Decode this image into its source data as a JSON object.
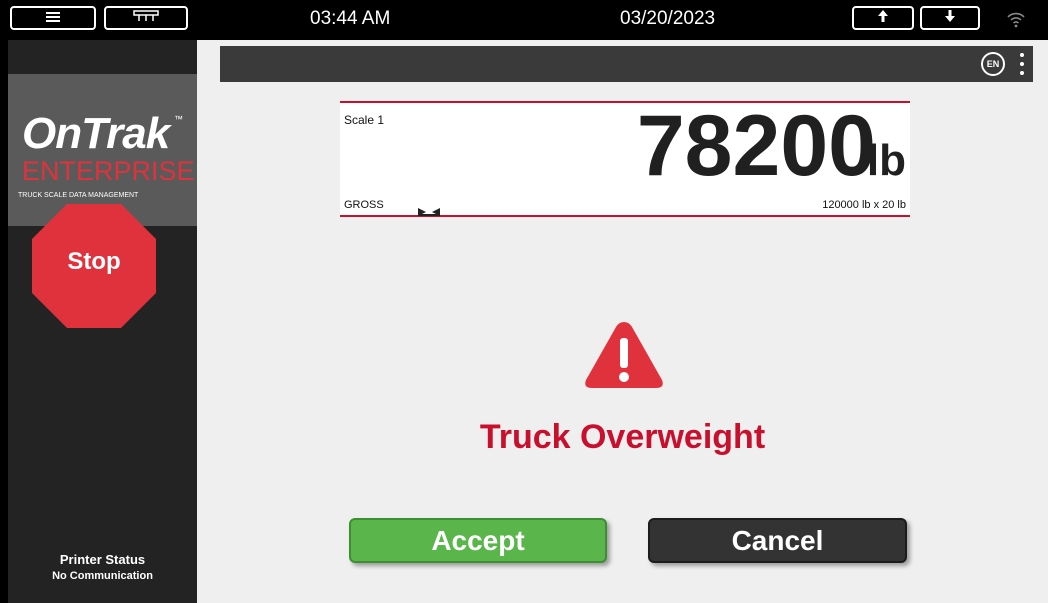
{
  "topbar": {
    "menu_icon": "hamburger-icon",
    "network_icon": "network-icon",
    "time": "03:44 AM",
    "date": "03/20/2023",
    "up_icon": "arrow-up-icon",
    "down_icon": "arrow-down-icon",
    "wifi_icon": "wifi-icon"
  },
  "sidebar": {
    "logo_main": "OnTrak",
    "logo_tm": "™",
    "logo_sub": "ENTERPRISE",
    "logo_tagline": "TRUCK SCALE DATA MANAGEMENT",
    "stop_label": "Stop",
    "printer_status_title": "Printer Status",
    "printer_status_value": "No Communication"
  },
  "header": {
    "language_badge": "EN",
    "menu_icon": "kebab-menu-icon"
  },
  "scale": {
    "name": "Scale 1",
    "weight": "78200",
    "unit": "lb",
    "mode": "GROSS",
    "capacity": "120000 lb x 20 lb",
    "motion_icon": "motion-indicator-icon"
  },
  "alert": {
    "icon": "warning-triangle-icon",
    "message": "Truck Overweight"
  },
  "actions": {
    "accept_label": "Accept",
    "cancel_label": "Cancel"
  },
  "colors": {
    "accent_red": "#c8102e",
    "accept_green": "#5ab54a",
    "cancel_dark": "#333333",
    "stop_red": "#e0323c"
  }
}
